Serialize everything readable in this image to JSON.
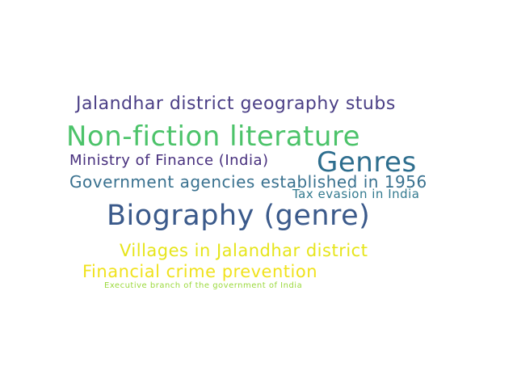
{
  "words": [
    {
      "text": "Jalandhar district geography stubs",
      "color": "#4b3f86"
    },
    {
      "text": "Non-fiction literature",
      "color": "#4cc36a"
    },
    {
      "text": "Ministry of Finance (India)",
      "color": "#472f7d"
    },
    {
      "text": "Genres",
      "color": "#2e6e8e"
    },
    {
      "text": "Government agencies established in 1956",
      "color": "#39718f"
    },
    {
      "text": "Tax evasion in India",
      "color": "#32798e"
    },
    {
      "text": "Biography (genre)",
      "color": "#3b5a8b"
    },
    {
      "text": "Villages in Jalandhar district",
      "color": "#e6e51a"
    },
    {
      "text": "Financial crime prevention",
      "color": "#f0e21c"
    },
    {
      "text": "Executive branch of the government of India",
      "color": "#9bd93c"
    }
  ]
}
